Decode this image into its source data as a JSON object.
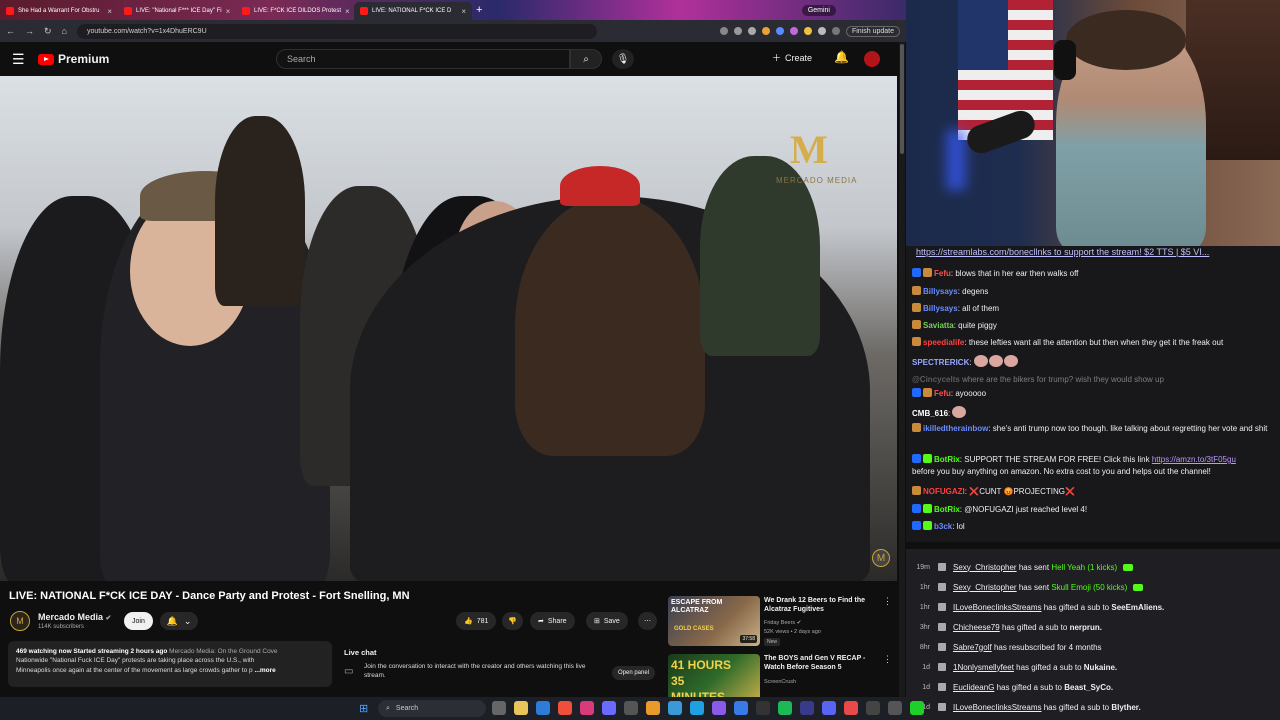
{
  "browser": {
    "tabs": [
      {
        "title": "She Had a Warrant For Obstru",
        "active": false
      },
      {
        "title": "LIVE: \"National F*** ICE Day\" Fi",
        "active": false
      },
      {
        "title": "LIVE: F*CK ICE DILDOS Protest",
        "active": false
      },
      {
        "title": "LIVE: NATIONAL F*CK ICE D",
        "active": true
      }
    ],
    "gemini_label": "Gemini",
    "url": "youtube.com/watch?v=1x4DhuERC9U",
    "finish_update": "Finish update"
  },
  "youtube": {
    "brand": "Premium",
    "search_placeholder": "Search",
    "create_label": "Create"
  },
  "video": {
    "watermark_letter": "M",
    "watermark_text": "MERCADO MEDIA",
    "title": "LIVE: NATIONAL F*CK ICE DAY - Dance Party and Protest - Fort Snelling, MN",
    "channel": "Mercado Media",
    "subscribers": "114K subscribers",
    "join_label": "Join",
    "likes": "781",
    "share_label": "Share",
    "save_label": "Save",
    "description": {
      "stats": "469 watching now  Started streaming 2 hours ago",
      "tag": "Mercado Media: On the Ground Cove",
      "line2": "Nationwide \"National Fuck ICE Day\" protests are taking place across the U.S., with",
      "line3": "Minneapolis once again at the center of the movement as large crowds gather to p",
      "more": "...more"
    },
    "livechat": {
      "title": "Live chat",
      "text": "Join the conversation to interact with the creator and others watching this live stream.",
      "open_panel": "Open panel"
    },
    "recommendations": [
      {
        "title": "We Drank 12 Beers to Find the Alcatraz Fugitives",
        "channel": "Friday Beers",
        "meta": "52K views • 2 days ago",
        "badge": "New",
        "duration": "37:58",
        "thumb_text": "ESCAPE FROM ALCATRAZ"
      },
      {
        "title": "The BOYS and Gen V RECAP - Watch Before Season 5",
        "channel": "ScreenCrush",
        "meta": "",
        "badge": "",
        "duration": "",
        "thumb_text": "41 HOURS 35 MINUTES"
      }
    ]
  },
  "stream": {
    "pinned": "https://streamlabs.com/bonecllnks to support the stream! $2 TTS | $5 VI...",
    "chat": [
      {
        "name": "Fefu",
        "text": "blows that in her ear then walks off",
        "color": "#ff4f4f",
        "badges": [
          "#1f69ff",
          "#c98a3b"
        ]
      },
      {
        "name": "Billysays",
        "text": "degens",
        "color": "#6a8cff",
        "badges": [
          "#c98a3b"
        ]
      },
      {
        "name": "Billysays",
        "text": "all of them",
        "color": "#6a8cff",
        "badges": [
          "#c98a3b"
        ]
      },
      {
        "name": "Saviatta",
        "text": "quite piggy",
        "color": "#79d05f",
        "badges": [
          "#c98a3b"
        ]
      },
      {
        "name": "speedialife",
        "text": "these lefties want all the attention but then when they get it the freak out",
        "color": "#ff4040",
        "badges": [
          "#c98a3b"
        ]
      },
      {
        "name": "SPECTRERICK",
        "text": "",
        "color": "#9aa8ff",
        "badges": [],
        "emotes": 3
      },
      {
        "name": "@Cincycelts",
        "text": "where are the bikers for trump? wish they would show up",
        "color": "#aaaaaa",
        "badges": [],
        "faded": true
      },
      {
        "name": "Fefu",
        "text": "ayooooo",
        "color": "#ff4f4f",
        "badges": [
          "#1f69ff",
          "#c98a3b"
        ]
      },
      {
        "name": "CMB_616",
        "text": "",
        "color": "#ffffff",
        "badges": [],
        "emotes": 1
      },
      {
        "name": "ikilledtherainbow",
        "text": "she's anti trump now too though. like talking about regretting her vote and shit",
        "color": "#6a8cff",
        "badges": [
          "#c98a3b"
        ]
      },
      {
        "name": "BotRix",
        "text": "SUPPORT THE STREAM FOR FREE! Click this link",
        "link": "https://amzn.to/3tF05gu",
        "text2": "before you buy anything on amazon. No extra cost to you and helps out the channel!",
        "color": "#53fc18",
        "badges": [
          "#1f69ff",
          "#53fc18"
        ]
      },
      {
        "name": "NOFUGAZI",
        "text": "❌CUNT 😡PROJECTING❌",
        "color": "#ff4040",
        "badges": [
          "#c98a3b"
        ]
      },
      {
        "name": "BotRix",
        "text": "@NOFUGAZI just reached level 4!",
        "color": "#53fc18",
        "badges": [
          "#1f69ff",
          "#53fc18"
        ]
      },
      {
        "name": "b3ck",
        "text": "lol",
        "color": "#6a8cff",
        "badges": [
          "#1f69ff",
          "#53fc18"
        ]
      }
    ],
    "alerts": [
      {
        "time": "19m",
        "user": "Sexy_Christopher",
        "action": "has sent",
        "highlight": "Hell Yeah (1 kicks)",
        "cash": true
      },
      {
        "time": "1hr",
        "user": "Sexy_Christopher",
        "action": "has sent",
        "highlight": "Skull Emoji (50 kicks)",
        "cash": true
      },
      {
        "time": "1hr",
        "user": "ILoveBonecIinksStreams",
        "action": "has gifted a sub to",
        "target": "SeeEmAliens."
      },
      {
        "time": "3hr",
        "user": "Chicheese79",
        "action": "has gifted a sub to",
        "target": "nerprun."
      },
      {
        "time": "8hr",
        "user": "Sabre7golf",
        "action": "has resubscribed for 4 months",
        "target": ""
      },
      {
        "time": "1d",
        "user": "1Nonlysmellyfeet",
        "action": "has gifted a sub to",
        "target": "Nukaine."
      },
      {
        "time": "1d",
        "user": "EuclideanG",
        "action": "has gifted a sub to",
        "target": "Beast_SyCo."
      },
      {
        "time": "1d",
        "user": "ILoveBonecIinksStreams",
        "action": "has gifted a sub to",
        "target": "Blyther."
      }
    ]
  },
  "taskbar": {
    "search": "Search"
  }
}
